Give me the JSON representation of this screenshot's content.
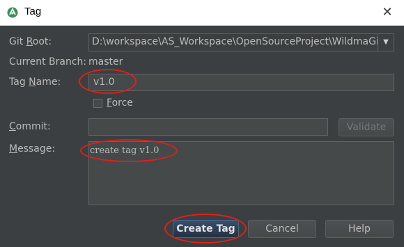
{
  "window": {
    "title": "Tag",
    "close_symbol": "✕"
  },
  "form": {
    "git_root": {
      "label_pre": "Git ",
      "label_mn": "R",
      "label_post": "oot:",
      "value": "D:\\workspace\\AS_Workspace\\OpenSourceProject\\WildmaGit"
    },
    "current_branch": {
      "label": "Current Branch:",
      "value": "master"
    },
    "tag_name": {
      "label_pre": "Tag ",
      "label_mn": "N",
      "label_post": "ame:",
      "value": "v1.0"
    },
    "force": {
      "label_mn": "F",
      "label_post": "orce",
      "checked": false
    },
    "commit": {
      "label_mn": "C",
      "label_post": "ommit:",
      "value": ""
    },
    "validate_label": "Validate",
    "message": {
      "label_mn": "M",
      "label_post": "essage:",
      "value": "create tag v1.0"
    }
  },
  "buttons": {
    "create_tag": "Create Tag",
    "cancel": "Cancel",
    "help": "Help"
  },
  "colors": {
    "dialog_bg": "#3c3f41",
    "annotation": "#e0201a",
    "primary_button": "#2d4158"
  }
}
